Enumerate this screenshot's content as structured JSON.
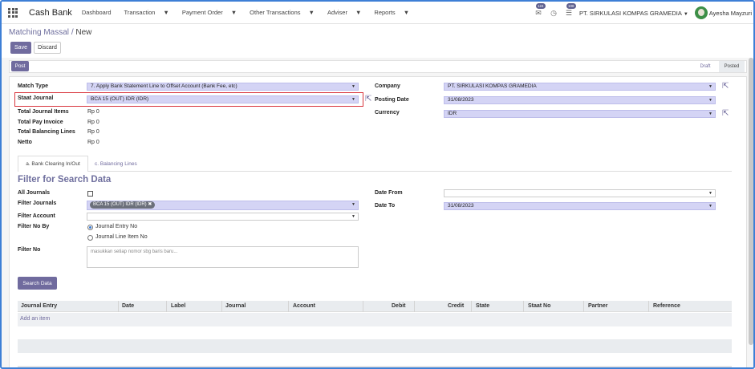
{
  "topbar": {
    "brand": "Cash Bank",
    "menu": [
      "Dashboard",
      "Transaction",
      "Payment Order",
      "Other Transactions",
      "Adviser",
      "Reports"
    ],
    "menu_has_caret": [
      false,
      true,
      true,
      true,
      true,
      true
    ],
    "badge_chat": "124",
    "badge_activity": "108",
    "company": "PT. SIRKULASI KOMPAS GRAMEDIA",
    "user": "Ayesha Mayzuri"
  },
  "breadcrumb": {
    "parent": "Matching Massal",
    "separator": "/",
    "current": "New"
  },
  "buttons": {
    "save": "Save",
    "discard": "Discard",
    "post": "Post",
    "search": "Search Data"
  },
  "status": {
    "draft": "Draft",
    "posted": "Posted"
  },
  "form": {
    "match_type_label": "Match Type",
    "match_type_value": "7. Apply Bank Statement Line to Offset Account (Bank Fee, etc)",
    "staat_journal_label": "Staat Journal",
    "staat_journal_value": "BCA 15 (OUT) IDR (IDR)",
    "total_journal_items_label": "Total Journal Items",
    "total_journal_items_value": "Rp 0",
    "total_pay_invoice_label": "Total Pay Invoice",
    "total_pay_invoice_value": "Rp 0",
    "total_balancing_lines_label": "Total Balancing Lines",
    "total_balancing_lines_value": "Rp 0",
    "netto_label": "Netto",
    "netto_value": "Rp 0",
    "company_label": "Company",
    "company_value": "PT. SIRKULASI KOMPAS GRAMEDIA",
    "posting_date_label": "Posting Date",
    "posting_date_value": "31/08/2023",
    "currency_label": "Currency",
    "currency_value": "IDR"
  },
  "tabs": [
    "a. Bank Clearing In/Out",
    "c. Balancing Lines"
  ],
  "filter": {
    "title": "Filter for Search Data",
    "all_journals_label": "All Journals",
    "filter_journals_label": "Filter Journals",
    "filter_journals_tag": "BCA 15 (OUT) IDR (IDR)",
    "filter_account_label": "Filter Account",
    "filter_no_by_label": "Filter No By",
    "option_entry": "Journal Entry No",
    "option_line": "Journal Line Item No",
    "filter_no_label": "Filter No",
    "filter_no_placeholder": "masukkan setiap nomor sbg baris baru...",
    "date_from_label": "Date From",
    "date_from_value": "",
    "date_to_label": "Date To",
    "date_to_value": "31/08/2023"
  },
  "table": {
    "columns": [
      "Journal Entry",
      "Date",
      "Label",
      "Journal",
      "Account",
      "Debit",
      "Credit",
      "State",
      "Staat No",
      "Partner",
      "Reference"
    ],
    "add_line": "Add an item"
  },
  "colors": {
    "accent": "#706b9e",
    "highlight_border": "#d9363e",
    "required_field": "#d4d4f5"
  }
}
